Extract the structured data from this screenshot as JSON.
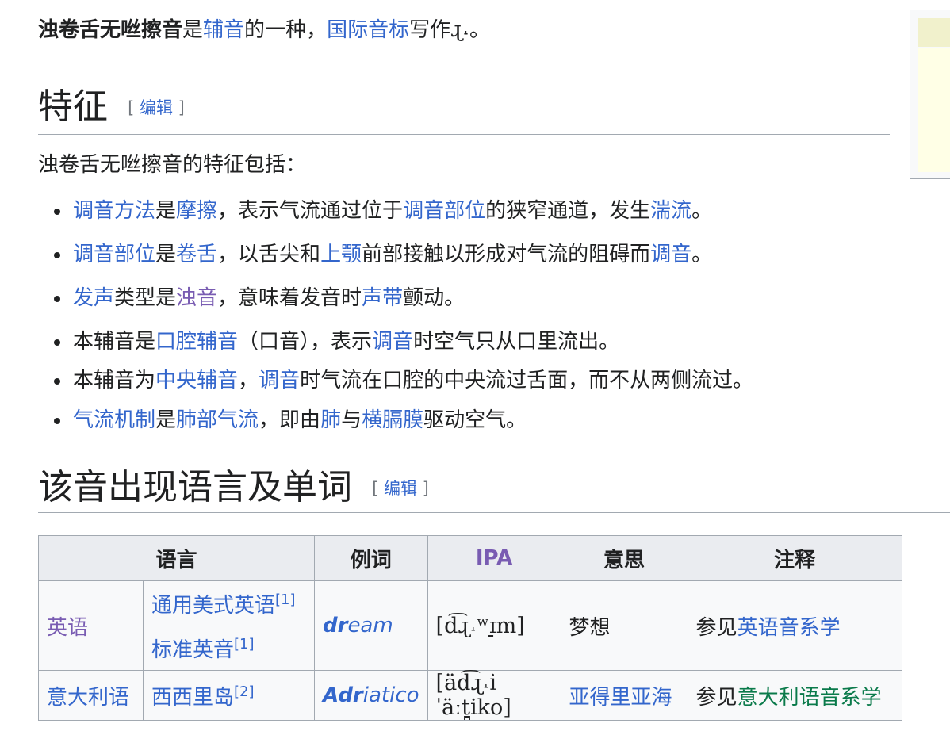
{
  "intro": {
    "title_bold": "浊卷舌无咝擦音",
    "t1": "是",
    "link1": "辅音",
    "t2": "的一种，",
    "link2": "国际音标",
    "t3": "写作",
    "symbol": "ɻ˔",
    "t4": "。"
  },
  "sections": [
    {
      "title": "特征",
      "edit_open": "[ ",
      "edit_label": "编辑",
      "edit_close": " ]"
    },
    {
      "title": "该音出现语言及单词",
      "edit_open": "[ ",
      "edit_label": "编辑",
      "edit_close": " ]"
    }
  ],
  "features_intro": "浊卷舌无咝擦音的特征包括：",
  "features": [
    [
      {
        "t": "调音方法",
        "link": true
      },
      {
        "t": "是"
      },
      {
        "t": "摩擦",
        "link": true
      },
      {
        "t": "，表示气流通过位于"
      },
      {
        "t": "调音部位",
        "link": true
      },
      {
        "t": "的狭窄通道，发生"
      },
      {
        "t": "湍流",
        "link": true
      },
      {
        "t": "。"
      }
    ],
    [
      {
        "t": "调音部位",
        "link": true
      },
      {
        "t": "是"
      },
      {
        "t": "卷舌",
        "link": true
      },
      {
        "t": "，以舌尖和"
      },
      {
        "t": "上颚",
        "link": true
      },
      {
        "t": "前部接触以形成对气流的阻碍而"
      },
      {
        "t": "调音",
        "link": true
      },
      {
        "t": "。"
      }
    ],
    [
      {
        "t": "发声",
        "link": true
      },
      {
        "t": "类型是"
      },
      {
        "t": "浊音",
        "link": true,
        "visited": true
      },
      {
        "t": "，意味着发音时"
      },
      {
        "t": "声带",
        "link": true
      },
      {
        "t": "颤动。"
      }
    ],
    [
      {
        "t": "本辅音是"
      },
      {
        "t": "口腔辅音",
        "link": true
      },
      {
        "t": "（口音），表示"
      },
      {
        "t": "调音",
        "link": true
      },
      {
        "t": "时空气只从口里流出。"
      }
    ],
    [
      {
        "t": "本辅音为"
      },
      {
        "t": "中央辅音",
        "link": true
      },
      {
        "t": "，"
      },
      {
        "t": "调音",
        "link": true
      },
      {
        "t": "时气流在口腔的中央流过舌面，而不从两侧流过。"
      }
    ],
    [
      {
        "t": "气流机制",
        "link": true
      },
      {
        "t": "是"
      },
      {
        "t": "肺部气流",
        "link": true
      },
      {
        "t": "，即由"
      },
      {
        "t": "肺",
        "link": true
      },
      {
        "t": "与"
      },
      {
        "t": "横膈膜",
        "link": true
      },
      {
        "t": "驱动空气。"
      }
    ]
  ],
  "table": {
    "headers": [
      "语言",
      "例词",
      "IPA",
      "意思",
      "注释"
    ],
    "english": "英语",
    "rows": [
      {
        "variety": "通用美式英语",
        "ref": "[1]",
        "word_a": "dr",
        "word_b": "eam",
        "ipa": "[d͡ɻ˔ʷɪ̠m]",
        "meaning": "梦想",
        "note_prefix": "参见",
        "note_link": "英语音系学"
      },
      {
        "variety": "标准英音",
        "ref": "[1]"
      },
      {
        "language": "意大利语",
        "variety": "西西里岛",
        "ref": "[2]",
        "word_a": "Adr",
        "word_b": "iatico",
        "ipa": "[äd͡ɻ˔iˈäːt̪iko]",
        "meaning": "亚得里亚海",
        "note_prefix": "参见",
        "note_link": "意大利语音系学"
      }
    ]
  }
}
